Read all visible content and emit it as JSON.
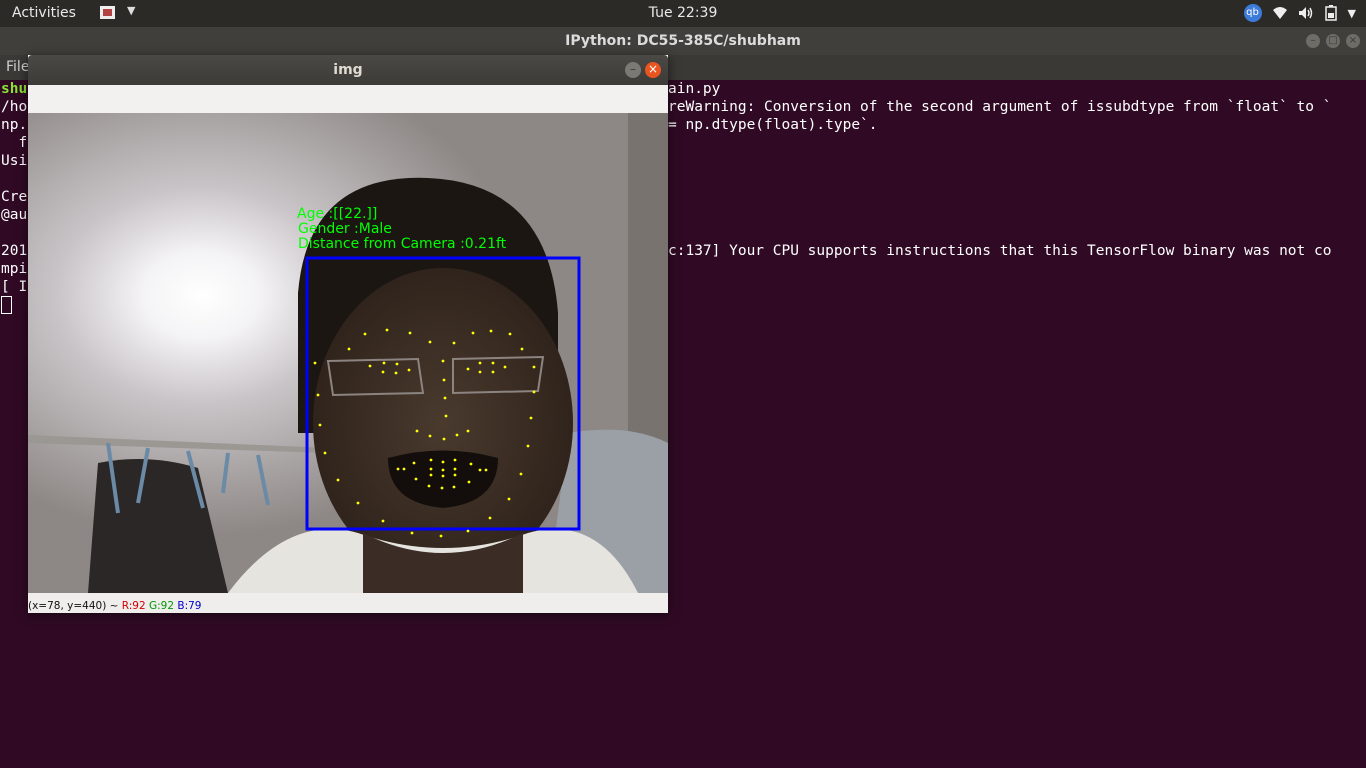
{
  "topbar": {
    "activities": "Activities",
    "clock": "Tue 22:39",
    "tray_icons": [
      "qbittorrent-icon",
      "wifi-icon",
      "volume-icon",
      "battery-icon",
      "chevron-down-icon"
    ],
    "qb_label": "qb"
  },
  "terminal": {
    "title": "IPython: DC55-385C/shubham",
    "menu_file": "File",
    "lines_left": [
      "shu",
      "/ho",
      "np.",
      "  f",
      "Usi",
      "",
      "Cre",
      "@au",
      "",
      "201",
      "mpi",
      "[ I"
    ],
    "lines_right": [
      "ain.py",
      "reWarning: Conversion of the second argument of issubdtype from `float` to `",
      "= np.dtype(float).type`.",
      "",
      "",
      "",
      "",
      "",
      "",
      "c:137] Your CPU supports instructions that this TensorFlow binary was not co"
    ]
  },
  "img_window": {
    "title": "img",
    "overlay": {
      "age": "Age :[[22.]]",
      "gender": "Gender :Male",
      "distance": "Distance from Camera :0.21ft"
    },
    "status": {
      "coords": "(x=78, y=440) ~ ",
      "r": "R:92",
      "g": "G:92",
      "b": "B:79"
    }
  },
  "colors": {
    "terminal_bg": "#300a24",
    "overlay_text": "#00ff00",
    "face_box": "#0000ff",
    "landmarks": "#ffff00"
  }
}
